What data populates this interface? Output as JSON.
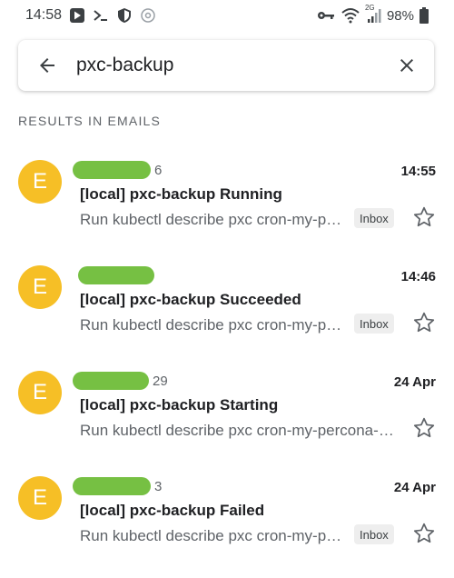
{
  "status_bar": {
    "time": "14:58",
    "signal_label": "2G",
    "battery": "98%"
  },
  "search": {
    "query": "pxc-backup"
  },
  "section_header": "RESULTS IN EMAILS",
  "emails": [
    {
      "avatar_letter": "E",
      "sender_suffix": "6",
      "time": "14:55",
      "subject": "[local] pxc-backup Running",
      "snippet": "Run kubectl describe pxc cron-my-percona-xtradb-cluster",
      "label": "Inbox",
      "avatar_color": "#f6bf26"
    },
    {
      "avatar_letter": "E",
      "sender_suffix": "",
      "time": "14:46",
      "subject": "[local] pxc-backup Succeeded",
      "snippet": "Run kubectl describe pxc cron-my-percona-xtradb-cluster",
      "label": "Inbox",
      "avatar_color": "#f6bf26"
    },
    {
      "avatar_letter": "E",
      "sender_suffix": "29",
      "time": "24 Apr",
      "subject": "[local] pxc-backup Starting",
      "snippet": "Run kubectl describe pxc cron-my-percona-xtradb-cluster",
      "label": "",
      "avatar_color": "#f6bf26"
    },
    {
      "avatar_letter": "E",
      "sender_suffix": "3",
      "time": "24 Apr",
      "subject": "[local] pxc-backup Failed",
      "snippet": "Run kubectl describe pxc cron-my-percona-xtradb-cluster",
      "label": "Inbox",
      "avatar_color": "#f6bf26"
    }
  ],
  "colors": {
    "redaction": "#76c043",
    "avatar": "#f6bf26"
  }
}
